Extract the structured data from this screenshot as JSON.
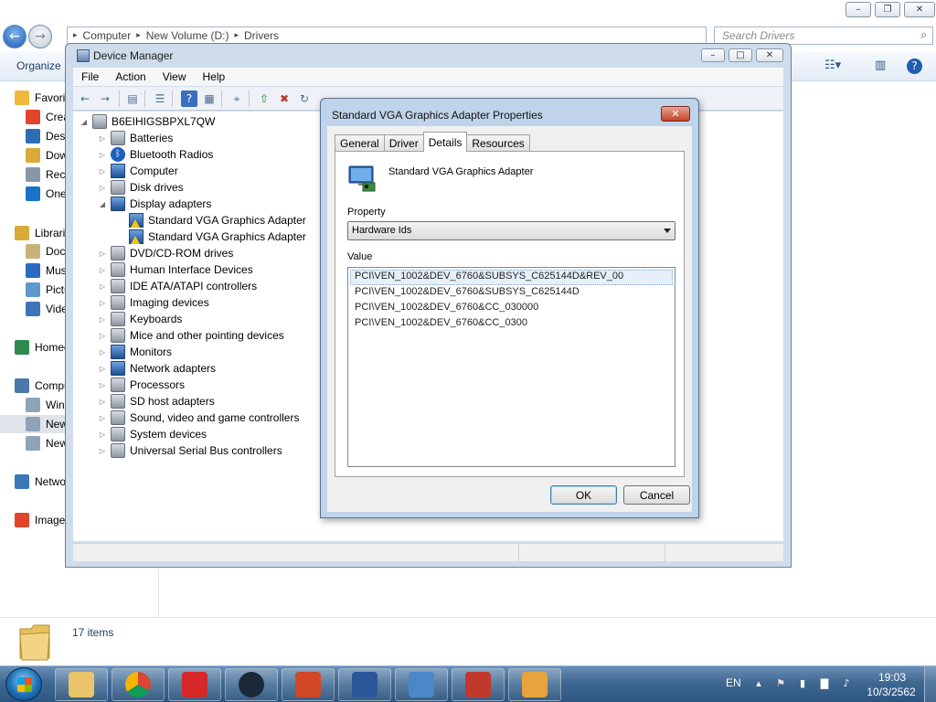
{
  "explorer": {
    "breadcrumb": [
      "Computer",
      "New Volume (D:)",
      "Drivers"
    ],
    "search_placeholder": "Search Drivers",
    "organize_label": "Organize",
    "nav_items": [
      {
        "label": "Favorites",
        "icon": "star-icon",
        "color": "#f0b83c"
      },
      {
        "label": "Creative Cloud Files",
        "icon": "creative-cloud-icon",
        "color": "#e2432b"
      },
      {
        "label": "Desktop",
        "icon": "desktop-icon",
        "color": "#2f6db2"
      },
      {
        "label": "Downloads",
        "icon": "downloads-icon",
        "color": "#d9a93a"
      },
      {
        "label": "Recent Places",
        "icon": "recent-places-icon",
        "color": "#8897a8"
      },
      {
        "label": "OneDrive",
        "icon": "onedrive-icon",
        "color": "#1a73c9"
      },
      {
        "label": "Libraries",
        "icon": "libraries-icon",
        "color": "#d9a93a"
      },
      {
        "label": "Documents",
        "icon": "documents-icon",
        "color": "#c9b27a"
      },
      {
        "label": "Music",
        "icon": "music-icon",
        "color": "#2a6bbf"
      },
      {
        "label": "Pictures",
        "icon": "pictures-icon",
        "color": "#5d9acb"
      },
      {
        "label": "Videos",
        "icon": "videos-icon",
        "color": "#3d74b8"
      },
      {
        "label": "Homegroup",
        "icon": "homegroup-icon",
        "color": "#2e8a4e"
      },
      {
        "label": "Computer",
        "icon": "computer-icon",
        "color": "#4b78a8"
      },
      {
        "label": "Windows (C:)",
        "icon": "drive-c-icon",
        "color": "#8fa3b8"
      },
      {
        "label": "New Volume (D:)",
        "icon": "drive-d-icon",
        "color": "#8fa3b8"
      },
      {
        "label": "New Volume (E:)",
        "icon": "drive-e-icon",
        "color": "#8fa3b8"
      },
      {
        "label": "Network",
        "icon": "network-icon",
        "color": "#3b78b6"
      },
      {
        "label": "Image",
        "icon": "image-folder-icon",
        "color": "#e2432b"
      }
    ],
    "item_count": "17 items"
  },
  "device_manager": {
    "title": "Device Manager",
    "menu": [
      "File",
      "Action",
      "View",
      "Help"
    ],
    "computer_name": "B6EIHIGSBPXL7QW",
    "categories": [
      {
        "label": "Batteries",
        "icon": "battery-icon"
      },
      {
        "label": "Bluetooth Radios",
        "icon": "bluetooth-icon"
      },
      {
        "label": "Computer",
        "icon": "computer-icon"
      },
      {
        "label": "Disk drives",
        "icon": "disk-drive-icon"
      },
      {
        "label": "Display adapters",
        "icon": "display-adapter-icon",
        "expanded": true,
        "children": [
          "Standard VGA Graphics Adapter",
          "Standard VGA Graphics Adapter"
        ]
      },
      {
        "label": "DVD/CD-ROM drives",
        "icon": "dvd-drive-icon"
      },
      {
        "label": "Human Interface Devices",
        "icon": "hid-icon"
      },
      {
        "label": "IDE ATA/ATAPI controllers",
        "icon": "ide-controller-icon"
      },
      {
        "label": "Imaging devices",
        "icon": "camera-icon"
      },
      {
        "label": "Keyboards",
        "icon": "keyboard-icon"
      },
      {
        "label": "Mice and other pointing devices",
        "icon": "mouse-icon"
      },
      {
        "label": "Monitors",
        "icon": "monitor-icon"
      },
      {
        "label": "Network adapters",
        "icon": "network-adapter-icon"
      },
      {
        "label": "Processors",
        "icon": "processor-icon"
      },
      {
        "label": "SD host adapters",
        "icon": "sd-card-icon"
      },
      {
        "label": "Sound, video and game controllers",
        "icon": "speaker-icon"
      },
      {
        "label": "System devices",
        "icon": "system-device-icon"
      },
      {
        "label": "Universal Serial Bus controllers",
        "icon": "usb-icon"
      }
    ]
  },
  "properties": {
    "title": "Standard VGA Graphics Adapter Properties",
    "tabs": [
      "General",
      "Driver",
      "Details",
      "Resources"
    ],
    "active_tab": "Details",
    "device_name": "Standard VGA Graphics Adapter",
    "property_label": "Property",
    "property_value": "Hardware Ids",
    "value_label": "Value",
    "values": [
      "PCI\\VEN_1002&DEV_6760&SUBSYS_C625144D&REV_00",
      "PCI\\VEN_1002&DEV_6760&SUBSYS_C625144D",
      "PCI\\VEN_1002&DEV_6760&CC_030000",
      "PCI\\VEN_1002&DEV_6760&CC_0300"
    ],
    "ok_label": "OK",
    "cancel_label": "Cancel"
  },
  "taskbar": {
    "apps": [
      {
        "name": "windows-explorer",
        "icon": "folder-icon",
        "color": "#e9c46a"
      },
      {
        "name": "google-chrome",
        "icon": "chrome-icon",
        "color": "#db4437"
      },
      {
        "name": "garena",
        "icon": "garena-icon",
        "color": "#d62828"
      },
      {
        "name": "steam",
        "icon": "steam-icon",
        "color": "#1b2838"
      },
      {
        "name": "powerpoint",
        "icon": "powerpoint-icon",
        "color": "#d24726"
      },
      {
        "name": "word",
        "icon": "word-icon",
        "color": "#2b579a"
      },
      {
        "name": "control-panel",
        "icon": "control-panel-icon",
        "color": "#4a88c7"
      },
      {
        "name": "toolbox",
        "icon": "toolbox-icon",
        "color": "#c0392b"
      },
      {
        "name": "paint",
        "icon": "paint-icon",
        "color": "#e8a33d"
      }
    ],
    "language": "EN",
    "time": "19:03",
    "date": "10/3/2562"
  }
}
